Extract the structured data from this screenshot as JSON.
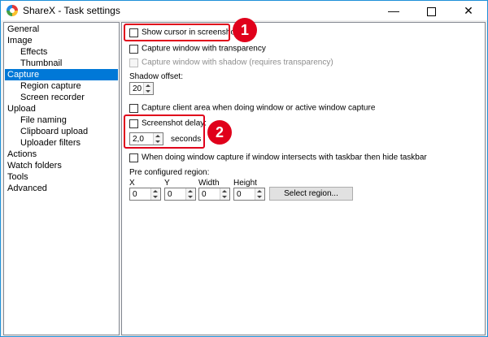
{
  "window": {
    "title": "ShareX - Task settings",
    "minimize_glyph": "—",
    "close_glyph": "✕"
  },
  "sidebar": {
    "items": [
      {
        "label": "General",
        "level": 0
      },
      {
        "label": "Image",
        "level": 0
      },
      {
        "label": "Effects",
        "level": 1
      },
      {
        "label": "Thumbnail",
        "level": 1
      },
      {
        "label": "Capture",
        "level": 0,
        "selected": true
      },
      {
        "label": "Region capture",
        "level": 1
      },
      {
        "label": "Screen recorder",
        "level": 1
      },
      {
        "label": "Upload",
        "level": 0
      },
      {
        "label": "File naming",
        "level": 1
      },
      {
        "label": "Clipboard upload",
        "level": 1
      },
      {
        "label": "Uploader filters",
        "level": 1
      },
      {
        "label": "Actions",
        "level": 0
      },
      {
        "label": "Watch folders",
        "level": 0
      },
      {
        "label": "Tools",
        "level": 0
      },
      {
        "label": "Advanced",
        "level": 0
      }
    ]
  },
  "capture": {
    "show_cursor": {
      "label": "Show cursor in screenshots",
      "checked": false
    },
    "capture_transparency": {
      "label": "Capture window with transparency",
      "checked": false
    },
    "capture_shadow": {
      "label": "Capture window with shadow (requires transparency)",
      "checked": false,
      "enabled": false
    },
    "shadow_offset": {
      "label": "Shadow offset:",
      "value": "20"
    },
    "client_area": {
      "label": "Capture client area when doing window or active window capture",
      "checked": false
    },
    "screenshot_delay": {
      "label": "Screenshot delay:",
      "checked": false,
      "value": "2,0",
      "unit": "seconds"
    },
    "hide_taskbar": {
      "label": "When doing window capture if window intersects with taskbar then hide taskbar",
      "checked": false
    },
    "preconfigured_region": {
      "label": "Pre configured region:",
      "x": {
        "label": "X",
        "value": "0"
      },
      "y": {
        "label": "Y",
        "value": "0"
      },
      "width": {
        "label": "Width",
        "value": "0"
      },
      "height": {
        "label": "Height",
        "value": "0"
      },
      "select_button": "Select region..."
    }
  },
  "annotations": [
    {
      "number": "1",
      "color": "#e0001b"
    },
    {
      "number": "2",
      "color": "#e0001b"
    }
  ]
}
